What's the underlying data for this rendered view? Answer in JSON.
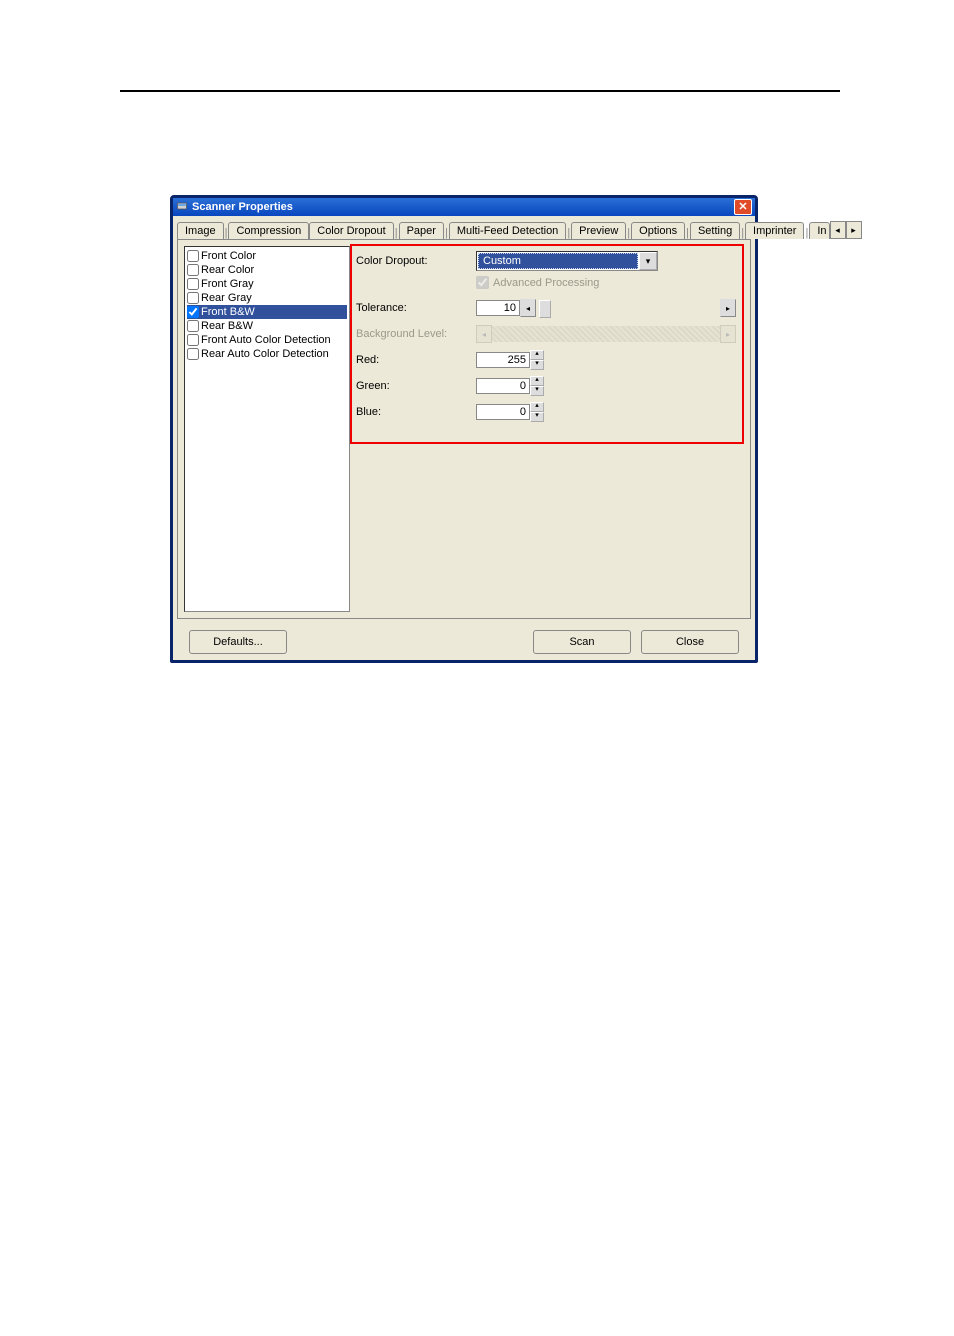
{
  "window": {
    "title": "Scanner Properties"
  },
  "tabs": {
    "items": [
      "Image",
      "Compression",
      "Color Dropout",
      "Paper",
      "Multi-Feed Detection",
      "Preview",
      "Options",
      "Setting",
      "Imprinter",
      "In"
    ],
    "active_index": 2
  },
  "left_list": {
    "items": [
      {
        "label": "Front Color",
        "checked": false,
        "selected": false
      },
      {
        "label": "Rear Color",
        "checked": false,
        "selected": false
      },
      {
        "label": "Front Gray",
        "checked": false,
        "selected": false
      },
      {
        "label": "Rear Gray",
        "checked": false,
        "selected": false
      },
      {
        "label": "Front B&W",
        "checked": true,
        "selected": true
      },
      {
        "label": "Rear B&W",
        "checked": false,
        "selected": false
      },
      {
        "label": "Front Auto Color Detection",
        "checked": false,
        "selected": false
      },
      {
        "label": "Rear Auto Color Detection",
        "checked": false,
        "selected": false
      }
    ]
  },
  "panel": {
    "color_dropout_label": "Color Dropout:",
    "color_dropout_value": "Custom",
    "advanced_label": "Advanced Processing",
    "advanced_checked": true,
    "tolerance_label": "Tolerance:",
    "tolerance_value": "10",
    "background_label": "Background Level:",
    "background_disabled": true,
    "red_label": "Red:",
    "red_value": "255",
    "green_label": "Green:",
    "green_value": "0",
    "blue_label": "Blue:",
    "blue_value": "0"
  },
  "buttons": {
    "defaults": "Defaults...",
    "scan": "Scan",
    "close": "Close"
  }
}
